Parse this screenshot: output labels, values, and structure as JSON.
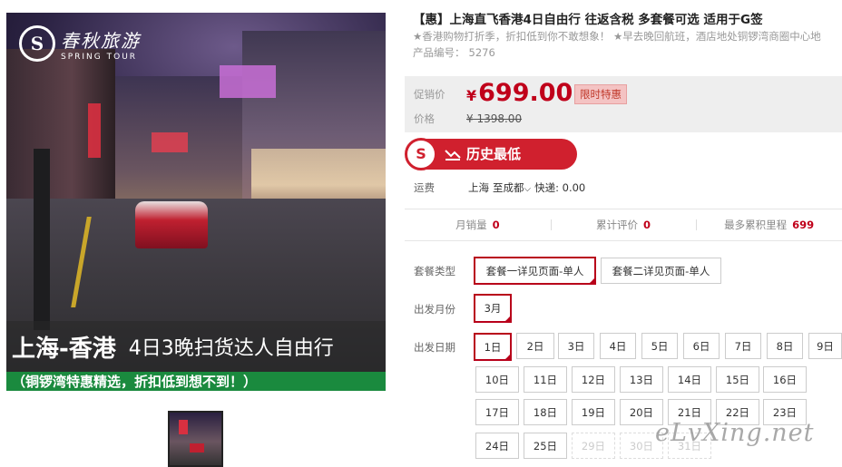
{
  "image": {
    "brand_mark": "S",
    "brand_cn": "春秋旅游",
    "brand_en": "SPRING TOUR",
    "banner_title": "上海-香港",
    "banner_title_rest": "4日3晚扫货达人自由行",
    "banner_sub": "（铜锣湾特惠精选，折扣低到想不到！）"
  },
  "product": {
    "title": "【惠】上海直飞香港4日自由行 往返含税 多套餐可选 适用于G签",
    "subtitle": "★香港购物打折季，折扣低到你不敢想象！ ★早去晚回航班，酒店地处铜锣湾商圈中心地",
    "code_label": "产品编号：",
    "code_value": "5276"
  },
  "price": {
    "promo_label": "促销价",
    "currency": "¥",
    "promo_value": "699.00",
    "badge": "限时特惠",
    "orig_label": "价格",
    "orig_value": "¥ 1398.00"
  },
  "lowest": {
    "icon_text": "S",
    "label": "历史最低"
  },
  "shipping": {
    "label": "运费",
    "from": "上海",
    "to": "至成都",
    "express": "快递: 0.00"
  },
  "stats": [
    {
      "label": "月销量",
      "value": "0"
    },
    {
      "label": "累计评价",
      "value": "0"
    },
    {
      "label": "最多累积里程",
      "value": "699"
    }
  ],
  "options": {
    "package_label": "套餐类型",
    "packages": [
      "套餐一详见页面-单人",
      "套餐二详见页面-单人"
    ],
    "month_label": "出发月份",
    "month": "3月",
    "date_label": "出发日期",
    "dates": [
      "1日",
      "2日",
      "3日",
      "4日",
      "5日",
      "6日",
      "7日",
      "8日",
      "9日",
      "10日",
      "11日",
      "12日",
      "13日",
      "14日",
      "15日",
      "16日",
      "17日",
      "18日",
      "19日",
      "20日",
      "21日",
      "22日",
      "23日",
      "24日",
      "25日",
      "29日",
      "30日",
      "31日"
    ]
  },
  "watermark": "eLvXing.net",
  "colors": {
    "accent": "#c0001a",
    "banner_green": "#1a8a3e",
    "lowest_red": "#d0202e"
  }
}
